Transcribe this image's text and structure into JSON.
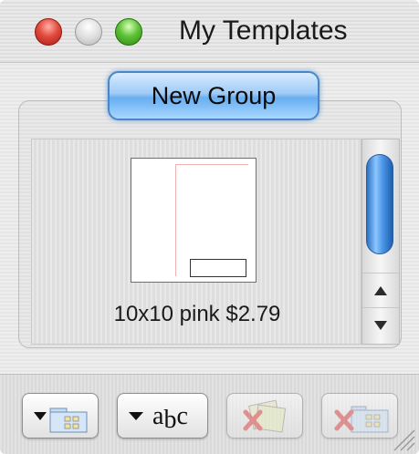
{
  "window": {
    "title": "My Templates"
  },
  "group": {
    "button_label": "New Group"
  },
  "templates": [
    {
      "caption": "10x10 pink $2.79"
    }
  ],
  "toolbar": {
    "buttons": [
      {
        "name": "folder-menu",
        "icon": "folder-grid-icon",
        "enabled": true
      },
      {
        "name": "text-style-menu",
        "icon": "abc-text-icon",
        "label_a": "a",
        "label_b": "b",
        "label_c": "c",
        "enabled": true
      },
      {
        "name": "delete-template",
        "icon": "delete-pages-icon",
        "enabled": false
      },
      {
        "name": "delete-group",
        "icon": "delete-folder-icon",
        "enabled": false
      }
    ]
  },
  "colors": {
    "accent": "#67aef1",
    "close": "#e24a3e",
    "zoom": "#5ec137"
  }
}
